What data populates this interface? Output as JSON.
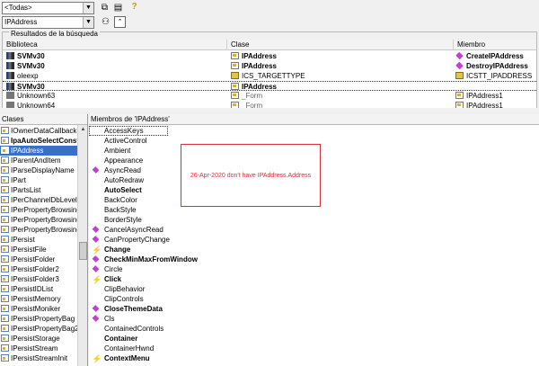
{
  "toolbar": {
    "library_combo": "<Todas>",
    "search_combo": "IPAddress",
    "search_button_icon": "binoculars-icon",
    "collapse_button_icon": "collapse-up-icon",
    "copy_icon": "copy-icon",
    "view_definition_icon": "view-definition-icon",
    "help_icon": "help-icon"
  },
  "results": {
    "label": "Resultados de la búsqueda",
    "columns": [
      "Biblioteca",
      "Clase",
      "Miembro"
    ],
    "rows": [
      {
        "lib": "SVMv30",
        "lib_icon": "library-icon",
        "class": "IPAddress",
        "class_icon": "interface-icon",
        "member": "CreateIPAddress",
        "member_icon": "method-icon",
        "bold": true
      },
      {
        "lib": "SVMv30",
        "lib_icon": "library-icon",
        "class": "IPAddress",
        "class_icon": "interface-icon",
        "member": "DestroyIPAddress",
        "member_icon": "method-icon",
        "bold": true
      },
      {
        "lib": "oleexp",
        "lib_icon": "library-icon",
        "class": "ICS_TARGETTYPE",
        "class_icon": "enum-icon",
        "member": "ICSTT_IPADDRESS",
        "member_icon": "constant-icon",
        "bold": false
      },
      {
        "lib": "SVMv30",
        "lib_icon": "library-icon",
        "class": "IPAddress",
        "class_icon": "interface-icon",
        "member": "",
        "member_icon": "",
        "bold": true,
        "selected": true
      },
      {
        "lib": "Unknown63",
        "lib_icon": "unknown-library-icon",
        "class": "_Form",
        "class_icon": "interface-icon",
        "member": "IPAddress1",
        "member_icon": "property-icon",
        "bold": false
      },
      {
        "lib": "Unknown64",
        "lib_icon": "unknown-library-icon",
        "class": "_Form",
        "class_icon": "interface-icon",
        "member": "IPAddress1",
        "member_icon": "property-icon",
        "bold": false
      }
    ]
  },
  "classes": {
    "header": "Clases",
    "items": [
      "IOwnerDataCallback",
      "IpaAutoSelectConst",
      "IPAddress",
      "IParentAndItem",
      "IParseDisplayName",
      "IPart",
      "IPartsList",
      "IPerChannelDbLevel",
      "IPerPropertyBrowsing",
      "IPerPropertyBrowsing",
      "IPerPropertyBrowsing",
      "IPersist",
      "IPersistFile",
      "IPersistFolder",
      "IPersistFolder2",
      "IPersistFolder3",
      "IPersistIDList",
      "IPersistMemory",
      "IPersistMoniker",
      "IPersistPropertyBag",
      "IPersistPropertyBag2",
      "IPersistStorage",
      "IPersistStream",
      "IPersistStreamInit"
    ],
    "selected_index": 2,
    "bold_index": 1
  },
  "members": {
    "header": "Miembros de 'IPAddress'",
    "items": [
      {
        "name": "AccessKeys",
        "kind": "property",
        "bold": false
      },
      {
        "name": "ActiveControl",
        "kind": "property",
        "bold": false
      },
      {
        "name": "Ambient",
        "kind": "property",
        "bold": false
      },
      {
        "name": "Appearance",
        "kind": "property",
        "bold": false
      },
      {
        "name": "AsyncRead",
        "kind": "method",
        "bold": false
      },
      {
        "name": "AutoRedraw",
        "kind": "property",
        "bold": false
      },
      {
        "name": "AutoSelect",
        "kind": "property",
        "bold": true
      },
      {
        "name": "BackColor",
        "kind": "property",
        "bold": false
      },
      {
        "name": "BackStyle",
        "kind": "property",
        "bold": false
      },
      {
        "name": "BorderStyle",
        "kind": "property",
        "bold": false
      },
      {
        "name": "CancelAsyncRead",
        "kind": "method",
        "bold": false
      },
      {
        "name": "CanPropertyChange",
        "kind": "method",
        "bold": false
      },
      {
        "name": "Change",
        "kind": "event",
        "bold": true
      },
      {
        "name": "CheckMinMaxFromWindow",
        "kind": "method",
        "bold": true
      },
      {
        "name": "Circle",
        "kind": "method",
        "bold": false
      },
      {
        "name": "Click",
        "kind": "event",
        "bold": true
      },
      {
        "name": "ClipBehavior",
        "kind": "property",
        "bold": false
      },
      {
        "name": "ClipControls",
        "kind": "property",
        "bold": false
      },
      {
        "name": "CloseThemeData",
        "kind": "method",
        "bold": true
      },
      {
        "name": "Cls",
        "kind": "method",
        "bold": false
      },
      {
        "name": "ContainedControls",
        "kind": "property",
        "bold": false
      },
      {
        "name": "Container",
        "kind": "property",
        "bold": true
      },
      {
        "name": "ContainerHwnd",
        "kind": "property",
        "bold": false
      },
      {
        "name": "ContextMenu",
        "kind": "event",
        "bold": true
      }
    ]
  },
  "note": {
    "text": "26-Apr-2020 don't have IPAddress.Address",
    "color": "#d6303a"
  }
}
